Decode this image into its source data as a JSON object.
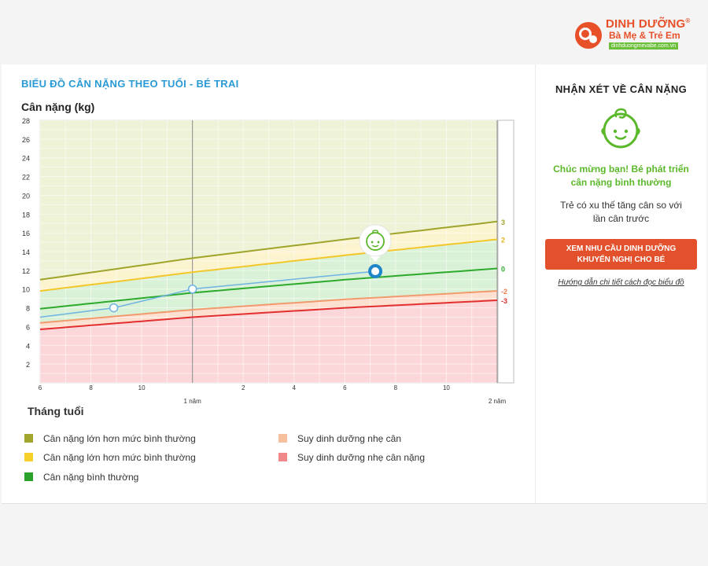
{
  "brand": {
    "line1": "DINH DƯỠNG",
    "reg": "®",
    "line2": "Bà Mẹ & Trẻ Em",
    "url": "dinhduongmevabe.com.vn",
    "color": "#e8502a",
    "url_bg": "#6cbf3a"
  },
  "chart_title": "BIỂU ĐỒ CÂN NẶNG THEO TUỔI - BÉ TRAI",
  "y_axis_title": "Cân nặng (kg)",
  "x_axis_title": "Tháng tuổi",
  "chart_data": {
    "type": "line",
    "x_range_months": [
      6,
      24
    ],
    "ylim": [
      0,
      28
    ],
    "y_ticks": [
      2,
      4,
      6,
      8,
      10,
      12,
      14,
      16,
      18,
      20,
      22,
      24,
      26,
      28
    ],
    "x_ticks": [
      {
        "m": 6,
        "label": "6"
      },
      {
        "m": 8,
        "label": "8"
      },
      {
        "m": 10,
        "label": "10"
      },
      {
        "m": 14,
        "label": "2"
      },
      {
        "m": 16,
        "label": "4"
      },
      {
        "m": 18,
        "label": "6"
      },
      {
        "m": 20,
        "label": "8"
      },
      {
        "m": 22,
        "label": "10"
      }
    ],
    "year_labels": [
      {
        "m": 12,
        "label": "1 năm"
      },
      {
        "m": 24,
        "label": "2 năm"
      }
    ],
    "curves": [
      {
        "sd": "3",
        "label": "3",
        "color": "#9fa42a",
        "label_color": "#9fa42a",
        "points": [
          [
            6,
            11.0
          ],
          [
            12,
            13.3
          ],
          [
            18,
            15.3
          ],
          [
            24,
            17.2
          ]
        ]
      },
      {
        "sd": "2",
        "label": "2",
        "color": "#f2c72b",
        "label_color": "#e0b520",
        "points": [
          [
            6,
            9.8
          ],
          [
            12,
            11.8
          ],
          [
            18,
            13.6
          ],
          [
            24,
            15.3
          ]
        ]
      },
      {
        "sd": "0",
        "label": "0",
        "color": "#2caa2c",
        "label_color": "#2caa2c",
        "points": [
          [
            6,
            7.9
          ],
          [
            12,
            9.6
          ],
          [
            18,
            11.0
          ],
          [
            24,
            12.2
          ]
        ]
      },
      {
        "sd": "-2",
        "label": "-2",
        "color": "#f29a6e",
        "label_color": "#f07a4a",
        "points": [
          [
            6,
            6.4
          ],
          [
            12,
            7.8
          ],
          [
            18,
            8.9
          ],
          [
            24,
            9.8
          ]
        ]
      },
      {
        "sd": "-3",
        "label": "-3",
        "color": "#e32f2f",
        "label_color": "#e32f2f",
        "points": [
          [
            6,
            5.7
          ],
          [
            12,
            7.0
          ],
          [
            18,
            8.0
          ],
          [
            24,
            8.8
          ]
        ]
      }
    ],
    "zones": {
      "above_3": "#eef2d6",
      "between_2_3": "#fcf3cf",
      "between_neg2_2": "#d9f1d6",
      "between_neg3_neg2": "#fde0cf",
      "below_neg3": "#fcd7d9"
    },
    "measurements": {
      "color": "#6fb3e3",
      "points": [
        [
          6,
          7.0
        ],
        [
          8.9,
          8.0
        ],
        [
          12,
          10.0
        ],
        [
          19.2,
          11.9
        ]
      ],
      "current_index": 3
    },
    "grid": true
  },
  "legend": [
    {
      "label": "Cân nặng lớn hơn mức bình thường",
      "color": "#a0a52e"
    },
    {
      "label": "Cân nặng lớn hơn mức bình thường",
      "color": "#f5cf2a"
    },
    {
      "label": "Cân nặng bình thường",
      "color": "#2aa12a"
    },
    {
      "label": "Suy dinh dưỡng nhẹ cân",
      "color": "#f6c09e"
    },
    {
      "label": "Suy dinh dưỡng nhẹ cân nặng",
      "color": "#f08a8a"
    }
  ],
  "sidebar": {
    "title": "NHẬN XÉT VỀ CÂN NẶNG",
    "message_line1": "Chúc mừng bạn! Bé phát triển",
    "message_line2": "cân nặng bình thường",
    "trend_line1": "Trẻ có xu thế tăng cân so với",
    "trend_line2": "lần cân trước",
    "cta_line1": "XEM NHU CẦU DINH DƯỠNG",
    "cta_line2": "KHUYẾN NGHỊ CHO BÉ",
    "guide_link": "Hướng dẫn chi tiết cách đọc biểu đồ",
    "accent_green": "#5cb82b",
    "cta_color": "#e2512c"
  }
}
